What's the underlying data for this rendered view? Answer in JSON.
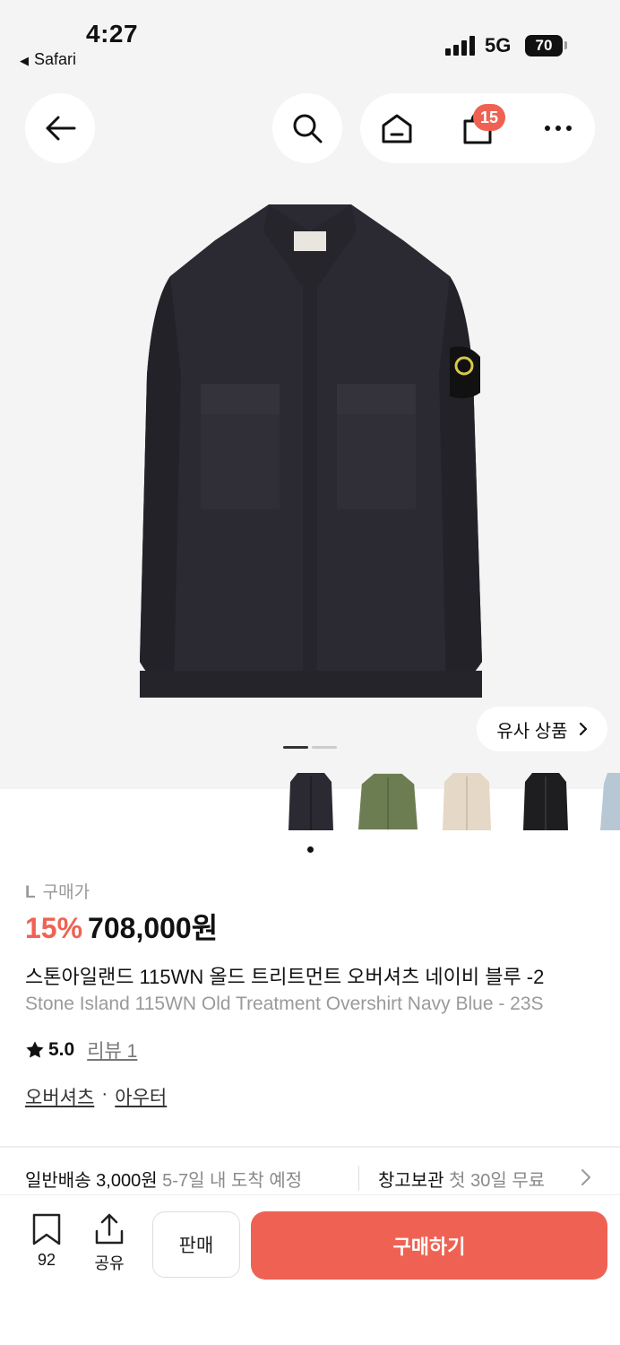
{
  "status": {
    "time": "4:27",
    "back_app": "Safari",
    "network": "5G",
    "battery": "70"
  },
  "header": {
    "cart_count": "15"
  },
  "colors": {
    "accent": "#ef6253",
    "jacket_navy": "#2b2a32",
    "jacket_green": "#6d7d52",
    "jacket_beige": "#e6d8c6",
    "jacket_black": "#1e1d20"
  },
  "icons": [
    "arrow-left-icon",
    "search-icon",
    "home-icon",
    "bag-icon",
    "more-icon",
    "chevron-right-icon",
    "star-icon",
    "bookmark-icon",
    "share-icon"
  ],
  "gallery": {
    "similar_label": "유사 상품"
  },
  "product": {
    "size": "L",
    "price_type": "구매가",
    "discount": "15%",
    "price": "708,000원",
    "title_ko": "스톤아일랜드 115WN 올드 트리트먼트 오버셔츠 네이비 블루 -2",
    "title_en": "Stone Island 115WN Old Treatment Overshirt Navy Blue - 23S",
    "rating": "5.0",
    "review_label": "리뷰 1",
    "category_1": "오버셔츠",
    "category_sep": "·",
    "category_2": "아우터"
  },
  "shipping": {
    "standard_label": "일반배송 3,000원",
    "standard_eta": "5-7일 내 도착 예정",
    "storage_label": "창고보관",
    "storage_offer": "첫 30일 무료"
  },
  "bottom": {
    "bookmark_count": "92",
    "share_label": "공유",
    "sell_label": "판매",
    "buy_label": "구매하기"
  }
}
